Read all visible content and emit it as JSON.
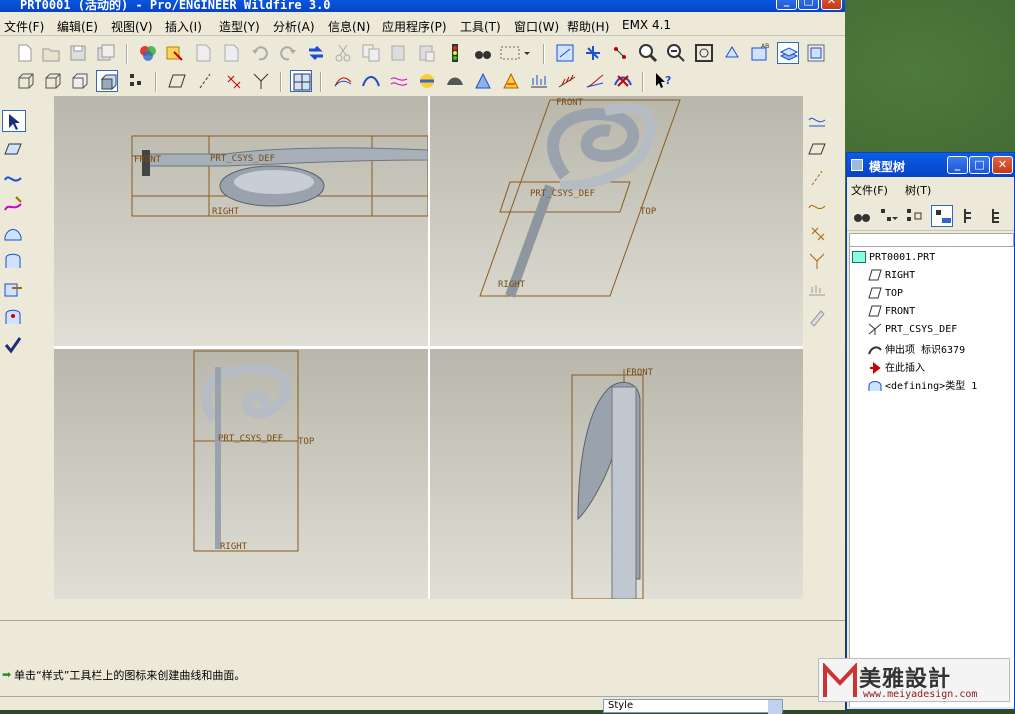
{
  "window": {
    "title": "PRT0001 (活动的) - Pro/ENGINEER Wildfire 3.0"
  },
  "menu": [
    "文件(F)",
    "编辑(E)",
    "视图(V)",
    "插入(I)",
    "造型(Y)",
    "分析(A)",
    "信息(N)",
    "应用程序(P)",
    "工具(T)",
    "窗口(W)",
    "帮助(H)",
    "EMX 4.1"
  ],
  "viewports": {
    "top_left": {
      "front": "FRONT",
      "csys": "PRT_CSYS_DEF",
      "right": "RIGHT"
    },
    "top_right": {
      "front": "FRONT",
      "csys": "PRT_CSYS_DEF",
      "top": "TOP",
      "right": "RIGHT"
    },
    "bottom_left": {
      "csys": "PRT_CSYS_DEF",
      "top": "TOP",
      "right": "RIGHT"
    },
    "bottom_right": {
      "front": "FRONT"
    }
  },
  "status": {
    "message": "单击“样式”工具栏上的图标来创建曲线和曲面。",
    "filter": "Style"
  },
  "model_tree": {
    "title": "模型树",
    "menu": [
      "文件(F)",
      "树(T)"
    ],
    "items": [
      {
        "label": "PRT0001.PRT",
        "icon": "part-icon"
      },
      {
        "label": "RIGHT",
        "icon": "datum-plane-icon"
      },
      {
        "label": "TOP",
        "icon": "datum-plane-icon"
      },
      {
        "label": "FRONT",
        "icon": "datum-plane-icon"
      },
      {
        "label": "PRT_CSYS_DEF",
        "icon": "csys-icon"
      },
      {
        "label": "伸出项 标识6379",
        "icon": "sweep-feature-icon"
      },
      {
        "label": "在此插入",
        "icon": "insert-here-arrow-icon"
      },
      {
        "label": "<defining>类型 1",
        "icon": "style-feature-icon"
      }
    ]
  },
  "watermark": {
    "text": "美雅設計",
    "url": "www.meiyadesign.com"
  },
  "colors": {
    "title_blue": "#0842c4",
    "datum_orange": "#8b5a1e",
    "insert_arrow": "#cc0000"
  }
}
